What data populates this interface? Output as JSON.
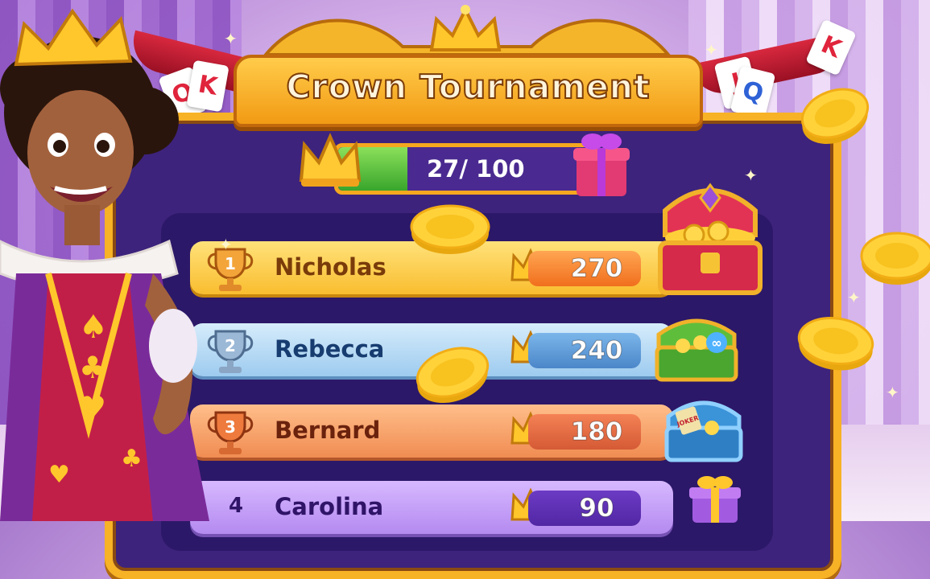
{
  "title": "Crown Tournament",
  "progress": {
    "text": "27/ 100",
    "current": 27,
    "max": 100
  },
  "leaderboard": [
    {
      "rank": "1",
      "name": "Nicholas",
      "score": "270"
    },
    {
      "rank": "2",
      "name": "Rebecca",
      "score": "240"
    },
    {
      "rank": "3",
      "name": "Bernard",
      "score": "180"
    },
    {
      "rank": "4",
      "name": "Carolina",
      "score": "90"
    }
  ],
  "cards": {
    "left": [
      "Q",
      "K"
    ],
    "right": [
      "J",
      "Q",
      "K"
    ]
  },
  "chests": {
    "r2_badge": "∞",
    "r3_label": "JOKER"
  },
  "colors": {
    "gold": "#f7b225",
    "panel": "#3d237c",
    "title_stroke": "#7a3b08"
  }
}
